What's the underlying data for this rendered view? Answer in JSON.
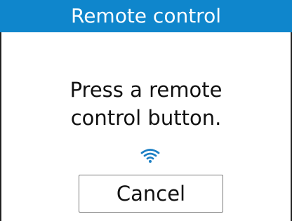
{
  "dialog": {
    "title": "Remote control",
    "message_line1": "Press a remote",
    "message_line2": "control button.",
    "status_icon": "wifi-icon",
    "cancel_label": "Cancel"
  },
  "colors": {
    "title_bar": "#0f86cc",
    "title_text": "#ffffff",
    "icon": "#1b7fc4",
    "text": "#111111",
    "button_border": "#7a7a7a"
  }
}
